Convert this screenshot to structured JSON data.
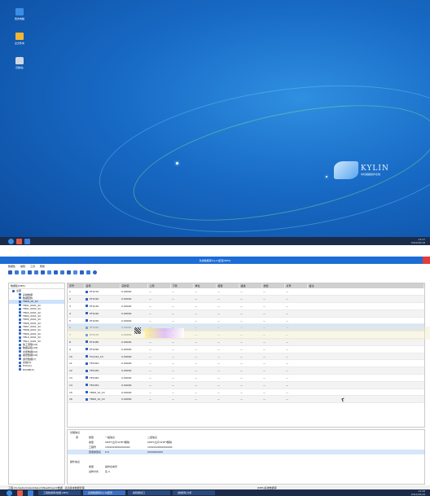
{
  "desktop": {
    "icons": [
      {
        "label": "我的电脑",
        "icon": "computer-icon",
        "color": "#3a8ee8"
      },
      {
        "label": "主文件夹",
        "icon": "folder-icon",
        "color": "#f2b531"
      },
      {
        "label": "回收站",
        "icon": "trash-icon",
        "color": "#cfd7e3"
      }
    ],
    "logo": {
      "big": "KYLIN",
      "small": "中标麒麟操作系统"
    },
    "tray": {
      "time": "14:27",
      "date": "2024/06/18"
    }
  },
  "app": {
    "title": "系统数据库[hy-0]配置[MES]",
    "menu": [
      "数据集",
      "编辑",
      "工具",
      "帮助"
    ],
    "toolbar_icons": [
      "save-icon",
      "print-icon",
      "refresh-icon",
      "copy-icon",
      "paste-icon",
      "cut-icon",
      "add-row-icon",
      "delete-row-icon",
      "filter-icon",
      "sort-icon",
      "settings-icon",
      "help-icon",
      "grid-icon",
      "info-icon"
    ],
    "tree": {
      "header": "数据集[MES]",
      "root": "全部",
      "items": [
        "系统数据",
        "数据结构",
        "TBKR_00_SC",
        "TB01_0001_SC",
        "TB01_0002_SC",
        "TB03_0001_SC",
        "TB04_0001_SC",
        "TB05_0001_SC",
        "TB06_0001_SC",
        "TB07_0001_SC",
        "TB08_0001_SC",
        "TB09_0001_SC",
        "TB10_0001_SC",
        "TB11_0001_SC",
        "热工测量[10]",
        "数据采集[18]",
        "水泵数据[20]",
        "报警数据[16]",
        "通讯数据[7]",
        "系统[3]",
        "HVC[4]",
        "ROOM[5]"
      ]
    },
    "grid": {
      "columns": [
        "序号",
        "名称",
        "实时值",
        "上限",
        "下限",
        "单位",
        "报警",
        "描述",
        "类型",
        "点号",
        "备注"
      ],
      "rows": [
        {
          "n": "1",
          "name": "PT1010",
          "val": "0.00000",
          "lim": "—"
        },
        {
          "n": "2",
          "name": "PT1020",
          "val": "0.00000",
          "lim": "—"
        },
        {
          "n": "3",
          "name": "PT1030",
          "val": "0.00000",
          "lim": "—"
        },
        {
          "n": "4",
          "name": "PT1040",
          "val": "0.00000",
          "lim": "—"
        },
        {
          "n": "5",
          "name": "PT1050",
          "val": "0.00000",
          "lim": "—"
        },
        {
          "n": "6",
          "name": "PT1060",
          "val": "0.00000",
          "lim": "—"
        },
        {
          "n": "7",
          "name": "PT1070",
          "val": "0.00000",
          "lim": "—"
        },
        {
          "n": "8",
          "name": "PT1080",
          "val": "0.00000",
          "lim": "—"
        },
        {
          "n": "9",
          "name": "PT1090",
          "val": "0.00000",
          "lim": "—"
        },
        {
          "n": "10",
          "name": "TC1010_10",
          "val": "0.00000",
          "lim": "—"
        },
        {
          "n": "11",
          "name": "TE1020",
          "val": "0.00000",
          "lim": "—"
        },
        {
          "n": "12",
          "name": "TE1030",
          "val": "0.00000",
          "lim": "—"
        },
        {
          "n": "13",
          "name": "TE1040",
          "val": "0.00000",
          "lim": "—"
        },
        {
          "n": "14",
          "name": "TE1050",
          "val": "0.00000",
          "lim": "—"
        },
        {
          "n": "15",
          "name": "TBKR_10_10",
          "val": "0.00000",
          "lim": "—"
        },
        {
          "n": "16",
          "name": "TBKR_10_10",
          "val": "0.00000",
          "lim": "—"
        }
      ]
    },
    "props": {
      "section1": "基础信息",
      "header": [
        "项",
        "类型",
        "一般信息",
        "二级信息"
      ],
      "rows": [
        {
          "a": "",
          "b": "类型",
          "c": "SHIFT之间 SHIFT删除",
          "d": "SHIFT之间 SHIFT删除"
        },
        {
          "a": "",
          "b": "工程号",
          "c": "1002010000000000",
          "d": "1002010000000000"
        },
        {
          "a": "",
          "b": "变量类型名",
          "c": "0.0",
          "d": "0000000000"
        },
        {
          "a": "",
          "b": "",
          "c": "",
          "d": ""
        }
      ],
      "section2": "额外信息",
      "extra": [
        {
          "b": "类型",
          "c": "操作基本符"
        },
        {
          "b": "采样方式",
          "c": "实 0"
        }
      ]
    },
    "status": {
      "left": "工程:/home/kylin/workbench/NewProject/数据 · 表达版本数据管理",
      "right": "[MES]系统数据库"
    },
    "tasks": [
      {
        "label": "工程数据库[数据-MES]"
      },
      {
        "label": "系统数据库[hy-0]配置"
      },
      {
        "label": "编辑器窗口"
      },
      {
        "label": "[数据库]分析"
      }
    ],
    "tray": {
      "time": "14:28",
      "date": "2024/06/18"
    }
  }
}
